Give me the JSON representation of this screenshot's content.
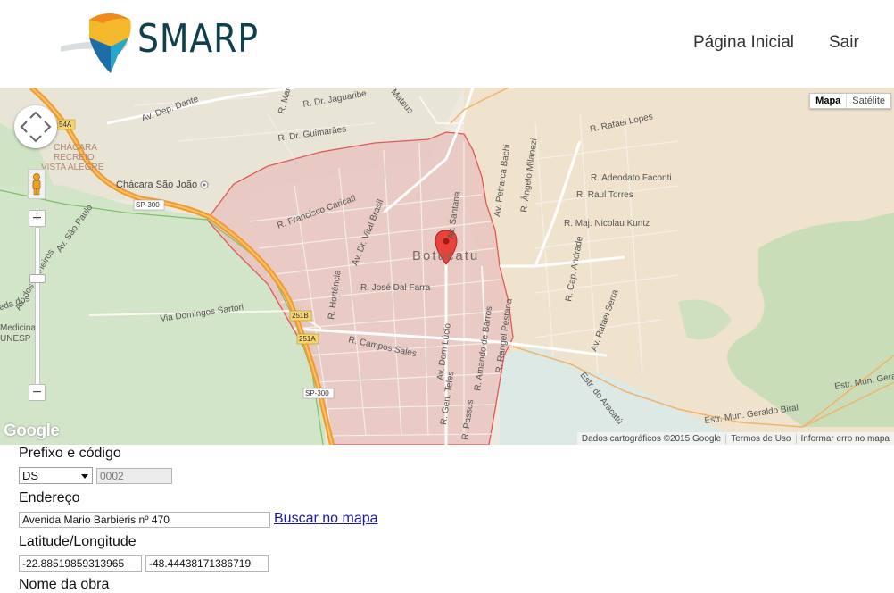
{
  "header": {
    "logo_text": "SMARP",
    "nav": [
      {
        "label": "Página Inicial"
      },
      {
        "label": "Sair"
      }
    ]
  },
  "map": {
    "city_label": "Botucatu",
    "map_type": {
      "map_label": "Mapa",
      "satellite_label": "Satélite",
      "selected": "Mapa"
    },
    "zoom": {
      "in_label": "+",
      "out_label": "−"
    },
    "google_logo": "Google",
    "attribution": {
      "data": "Dados cartográficos ©2015 Google",
      "terms": "Termos de Uso",
      "report": "Informar erro no mapa"
    },
    "labels": {
      "dep_dante": "Av. Dep. Dante",
      "dr_jaguaribe": "R. Dr. Jaguaribe",
      "dr_guimaraes": "R. Dr. Guimarães",
      "manilla": "R. Manilla",
      "mateus": "Mateus",
      "chacara_recreio": "CHÁCARA",
      "chacara_recreio2": "RECREIO",
      "chacara_recreio3": "VISTA ALEGRE",
      "chacara_sao_joao": "Chácara São João",
      "sp300a": "SP-300",
      "sp300b": "SP-300",
      "hwy_54a": "54A",
      "hwy_251b": "251B",
      "hwy_251a": "251A",
      "sao_paulo": "Av. São Paulo",
      "pinheiros": "Av. dos Pinheiros",
      "francisco_caricati": "R. Francisco Caricati",
      "vital_brasil": "Av. Dr. Vital Brasil",
      "santana": "Av. Santana",
      "petrarca": "Av. Petrarca Bachi",
      "angelo": "R. Ângelo Milanezi",
      "rafael_lopes": "R. Rafael Lopes",
      "adeodato": "R. Adeodato Faconti",
      "raul_torres": "R. Raul Torres",
      "nicolau": "R. Maj. Nicolau Kuntz",
      "jose_dal_farra": "R. José Dal Farra",
      "hortencia": "R. Hortência",
      "domingos_sartori": "Via Domingos Sartori",
      "campos_sales": "R. Campos Sales",
      "dom_lucio": "Av. Dom Lúcio",
      "amando": "R. Amando de Barros",
      "rangel": "R. Rangel Pestana",
      "cap_andrade": "R. Cap. Andrade",
      "rafael_serra": "Av. Rafael Serra",
      "aracatu": "Estr. do Aracatú",
      "geraldo_biral": "Estr. Mun. Geraldo Biral",
      "mun_gera": "Estr. Mun. Gera",
      "gen_teles": "R. Gen. Teles",
      "passos": "R. Passos",
      "medicina": "Medicina",
      "unesp": "UNESP",
      "meda": "meda dos"
    },
    "colors": {
      "city_fill": "#e8c4c0",
      "city_border": "#e05a55",
      "highway": "#f29a2e",
      "green": "#cfe3c5"
    }
  },
  "form": {
    "prefix_label": "Prefixo e código",
    "prefix_value": "DS",
    "code_value": "0002",
    "address_label": "Endereço",
    "address_value": "Avenida Mario Barbieris  nº 470",
    "search_link": "Buscar no mapa",
    "latlng_label": "Latitude/Longitude",
    "latitude": "-22.88519859313965",
    "longitude": "-48.44438171386719",
    "work_name_label": "Nome da obra"
  }
}
